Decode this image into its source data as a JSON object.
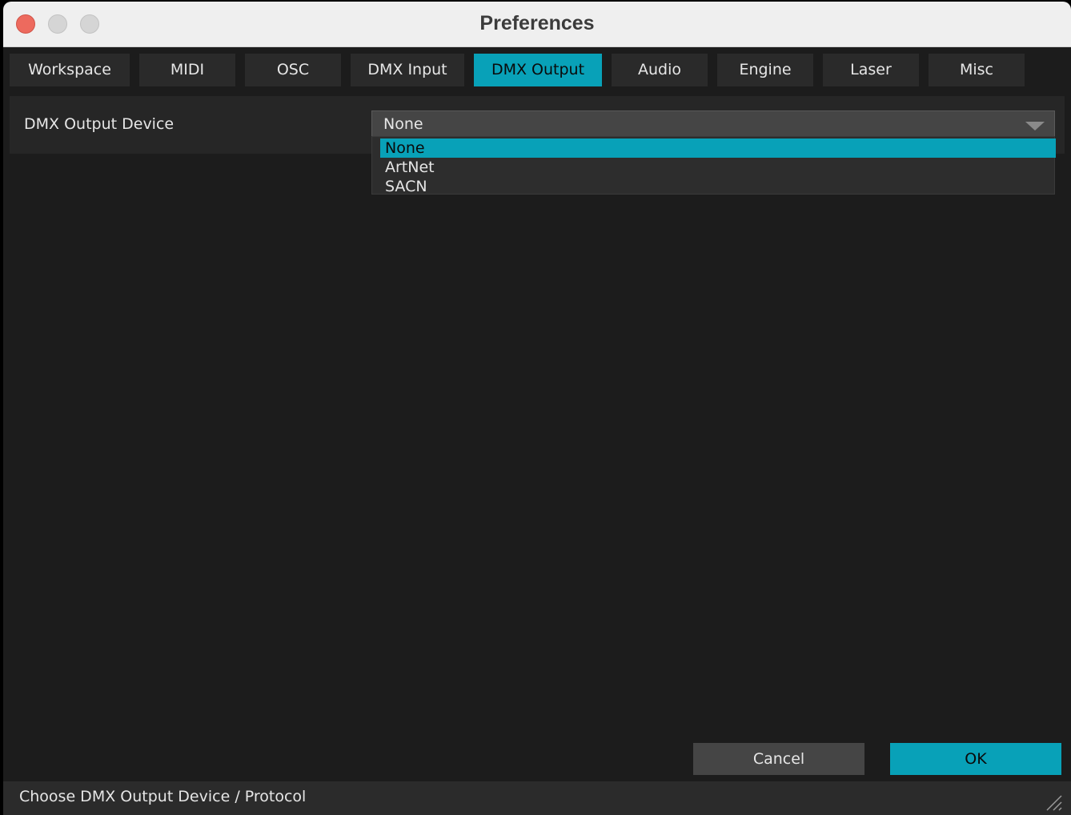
{
  "window": {
    "title": "Preferences"
  },
  "tabs": [
    {
      "label": "Workspace",
      "active": false
    },
    {
      "label": "MIDI",
      "active": false
    },
    {
      "label": "OSC",
      "active": false
    },
    {
      "label": "DMX Input",
      "active": false
    },
    {
      "label": "DMX Output",
      "active": true
    },
    {
      "label": "Audio",
      "active": false
    },
    {
      "label": "Engine",
      "active": false
    },
    {
      "label": "Laser",
      "active": false
    },
    {
      "label": "Misc",
      "active": false
    }
  ],
  "settings": {
    "device_label": "DMX Output Device",
    "device_value": "None",
    "options": [
      "None",
      "ArtNet",
      "SACN"
    ],
    "selected_option": "None"
  },
  "buttons": {
    "cancel": "Cancel",
    "ok": "OK"
  },
  "status": {
    "text": "Choose DMX Output Device / Protocol"
  },
  "colors": {
    "accent": "#08a1b8",
    "background": "#1c1c1c",
    "panel": "#262626"
  }
}
